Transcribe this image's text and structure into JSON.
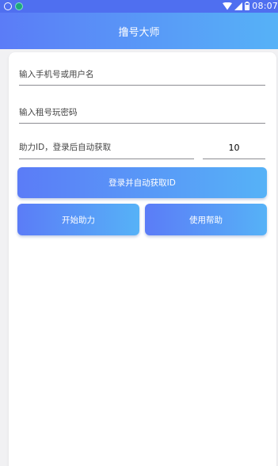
{
  "status_bar": {
    "time": "08:07"
  },
  "app_bar": {
    "title": "撸号大师"
  },
  "form": {
    "phone": {
      "value": "",
      "placeholder": "输入手机号或用户名"
    },
    "password": {
      "value": "",
      "placeholder": "输入租号玩密码"
    },
    "assist_id": {
      "value": "",
      "placeholder": "助力ID，登录后自动获取"
    },
    "count": {
      "value": "10"
    }
  },
  "buttons": {
    "login_label": "登录并自动获取ID",
    "start_label": "开始助力",
    "help_label": "使用帮助"
  },
  "colors": {
    "gradient_start": "#5b7cf7",
    "gradient_end": "#56b2f7",
    "status_bar_bg": "#4f6ff0",
    "page_bg": "#f1f1f3"
  }
}
